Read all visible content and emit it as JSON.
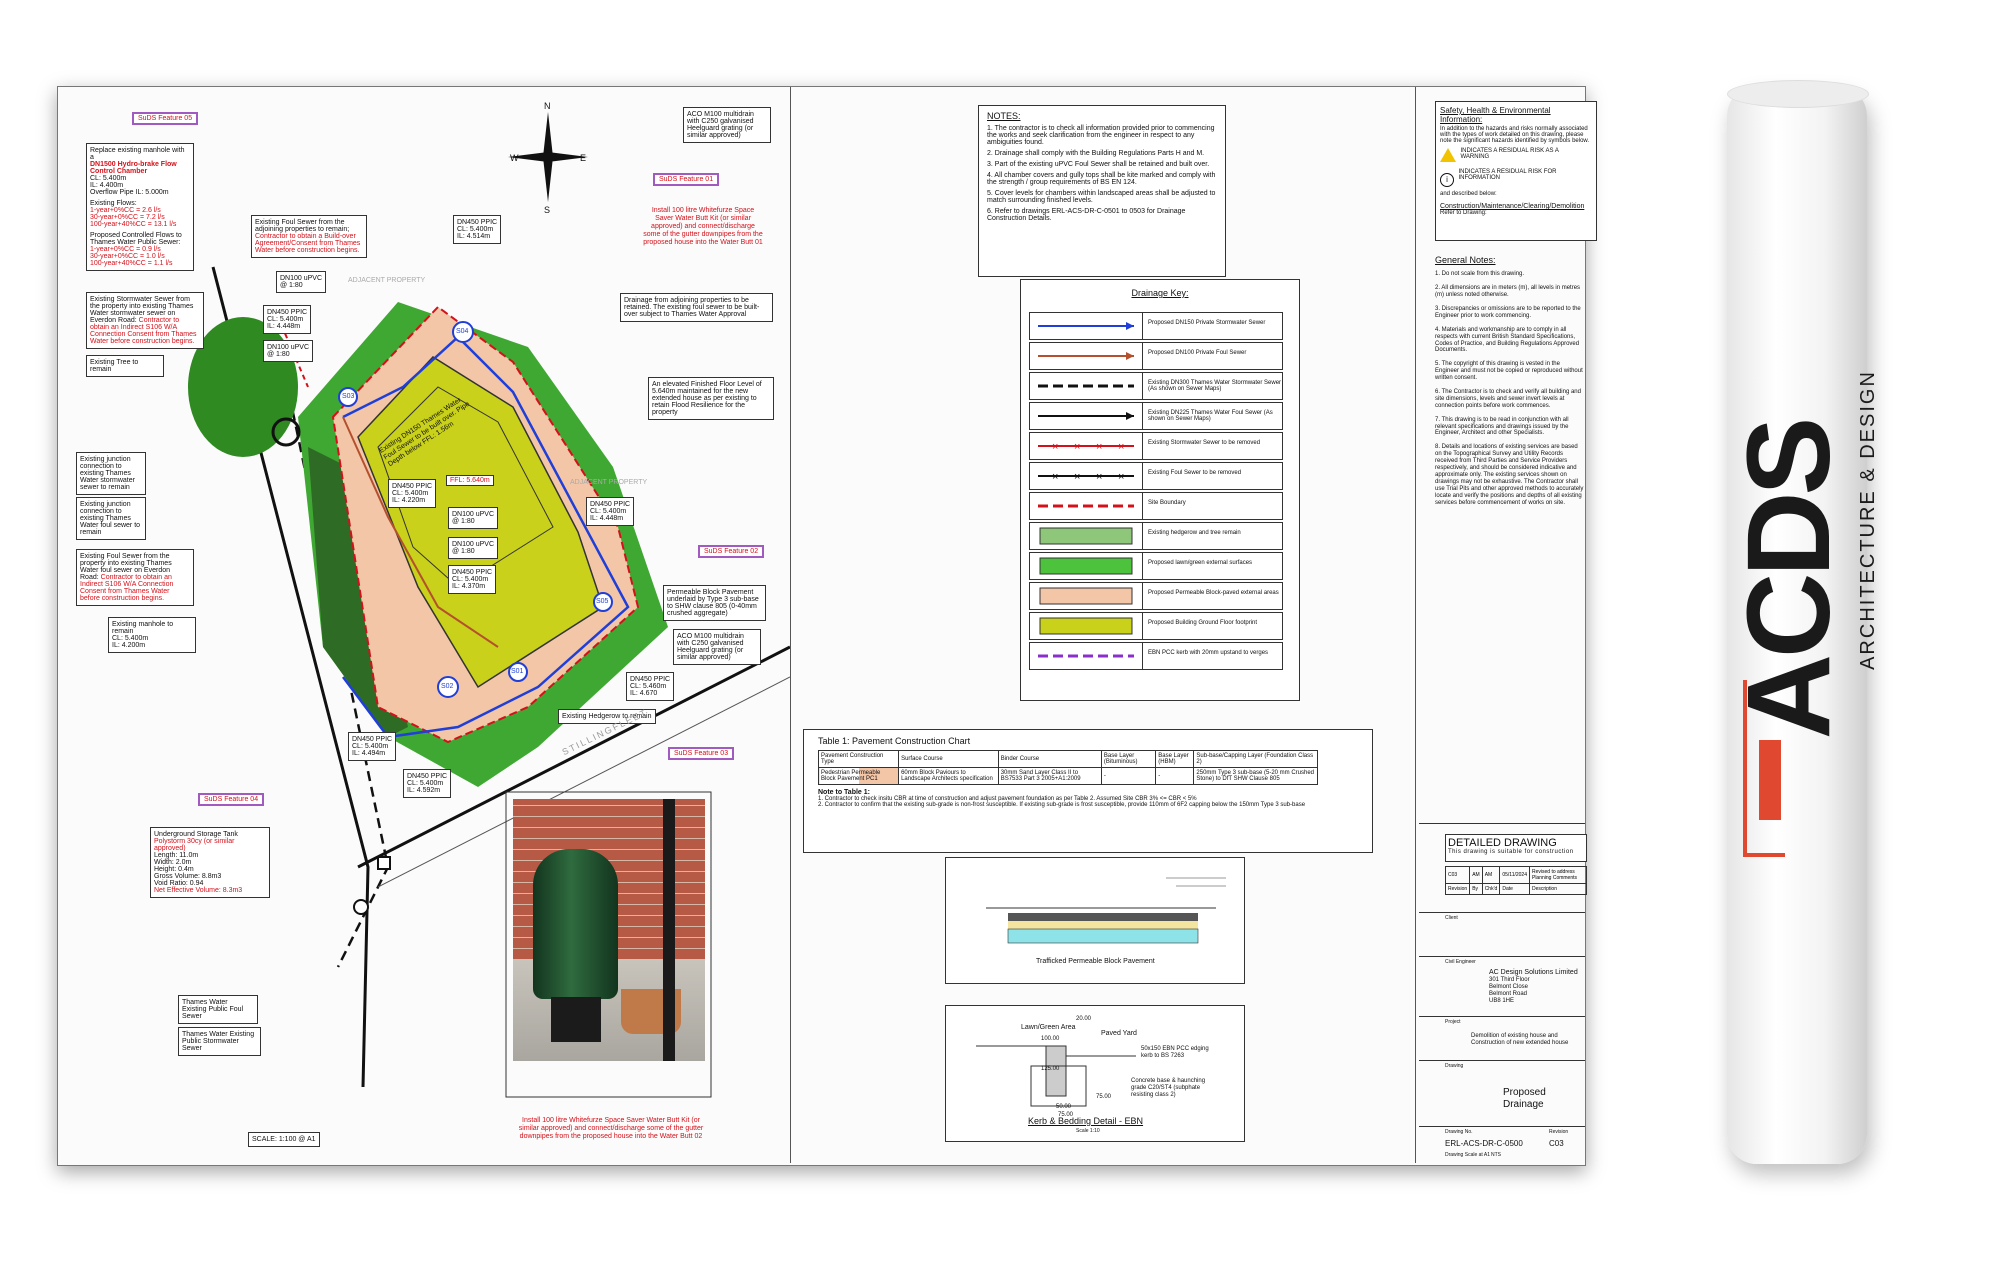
{
  "site_plan": {
    "suds_tags": [
      "SuDS Feature 05",
      "SuDS Feature 01",
      "SuDS Feature 02",
      "SuDS Feature 03",
      "SuDS Feature 04"
    ],
    "north": {
      "n": "N",
      "s": "S",
      "e": "E",
      "w": "W"
    },
    "manhole_callout": {
      "title_a": "Replace existing manhole with a",
      "title_b": "DN1500 Hydro-brake Flow Control Chamber",
      "lines": [
        "CL: 5.400m",
        "IL: 4.400m",
        "Overflow Pipe IL: 5.000m"
      ],
      "flows_title": "Existing Flows:",
      "flows": [
        "1-year+0%CC = 2.6 l/s",
        "30-year+0%CC = 7.2 l/s",
        "100-year+40%CC = 13.1 l/s"
      ],
      "proposed_title": "Proposed Controlled Flows to Thames Water Public Sewer:",
      "proposed": [
        "1-year+0%CC = 0.9 l/s",
        "30-year+0%CC = 1.0 l/s",
        "100-year+40%CC = 1.1 l/s"
      ]
    },
    "notes_left": [
      "Existing Stormwater Sewer from the property into existing Thames Water stormwater sewer on Everdon Road:",
      "Existing Tree to remain",
      "Existing junction connection to existing Thames Water stormwater sewer to remain",
      "Existing junction connection to existing Thames Water foul sewer to remain",
      "Existing Foul Sewer from the property into existing Thames Water foul sewer on Everdon Road:",
      "Existing manhole to remain"
    ],
    "notes_red_left": [
      "Contractor to obtain an Indirect S106 W/A Connection Consent from Thames Water before construction begins.",
      "Contractor to obtain an Indirect S106 W/A Connection Consent from Thames Water before construction begins."
    ],
    "manhole_left": [
      "CL: 5.400m",
      "IL: 4.200m"
    ],
    "foul_sewer_note": "Existing Foul Sewer from the adjoining properties to remain;",
    "foul_sewer_red": "Contractor to obtain a Build-over Agreement/Consent from Thames Water before construction begins.",
    "pipe_labels": [
      {
        "t": "DN100 uPVC",
        "v": "@ 1:80"
      },
      {
        "t": "DN450 PPIC",
        "v": "CL: 5.400m",
        "w": "IL: 4.448m"
      },
      {
        "t": "DN100 uPVC",
        "v": "@ 1:80"
      },
      {
        "t": "DN450 PPIC",
        "v": "CL: 5.400m",
        "w": "IL: 4.514m"
      },
      {
        "t": "DN450 PPIC",
        "v": "CL: 5.400m",
        "w": "IL: 4.220m"
      },
      {
        "t": "DN100 uPVC",
        "v": "@ 1:80"
      },
      {
        "t": "DN100 uPVC",
        "v": "@ 1:80"
      },
      {
        "t": "DN450 PPIC",
        "v": "CL: 5.400m",
        "w": "IL: 4.370m"
      },
      {
        "t": "DN450 PPIC",
        "v": "CL: 5.400m",
        "w": "IL: 4.448m"
      },
      {
        "t": "DN450 PPIC",
        "v": "CL: 5.400m",
        "w": "IL: 4.494m"
      },
      {
        "t": "DN450 PPIC",
        "v": "CL: 5.400m",
        "w": "IL: 4.592m"
      },
      {
        "t": "DN450 PPIC",
        "v": "CL: 5.460m",
        "w": "IL: 4.670"
      }
    ],
    "ffl": "FFL: 5.640m",
    "house_label": "Existing DN150 Thames Water Foul Sewer to be built over. Pipe Depth below FFL: 1.56m",
    "aco_top": "ACO M100 multidrain with C250 galvanised Heelguard grating (or similar approved)",
    "butt_top_red": "Install 100 litre Whitefurze Space Saver Water Butt Kit (or similar approved) and connect/discharge some of the gutter downpipes from the proposed house into the Water Butt 01",
    "drainage_adjoining": "Drainage from adjoining properties to be retained. The existing foul sewer to be built-over subject to Thames Water Approval",
    "floor_level": "An elevated Finished Floor Level of 5.640m maintained for the new extended house as per existing to retain Flood Resilience for the property",
    "permeable": "Permeable Block Pavement underlaid by Type 3 sub-base to SHW clause 805 (0-40mm crushed aggregate)",
    "aco_mid": "ACO M100 multidrain with C250 galvanised Heelguard grating (or similar approved)",
    "hedgerow": "Existing Hedgerow to remain",
    "storage_title": "Underground Storage Tank",
    "storage_red": "Polystorm 30cy (or similar approved)",
    "storage": [
      "Length: 11.0m",
      "Width: 2.0m",
      "Height: 0.4m",
      "Gross Volume: 8.8m3",
      "Void Ratio: 0.94"
    ],
    "storage_net": "Net Effective Volume: 8.3m3",
    "tw_foul": "Thames Water Existing Public Foul Sewer",
    "tw_storm": "Thames Water Existing Public Stormwater Sewer",
    "butt_photo_red": "Install 100 litre Whitefurze Space Saver Water Butt Kit (or similar approved) and connect/discharge some of the gutter downpipes from the proposed house into the Water Butt 02",
    "scale": "SCALE: 1:100 @ A1",
    "road": "STILLINGFLEET",
    "adjacent1": "ADJACENT PROPERTY",
    "adjacent2": "ADJACENT PROPERTY",
    "manholes": [
      "S04",
      "S03",
      "S05",
      "S02",
      "S01"
    ]
  },
  "notes": {
    "title": "NOTES:",
    "items": [
      "1. The contractor is to check all information provided prior to commencing the works and seek clarification from the engineer in respect to any ambiguities found.",
      "2. Drainage shall comply with the Building Regulations Parts H and M.",
      "3. Part of the existing uPVC Foul Sewer shall be retained and built over.",
      "4. All chamber covers and gully tops shall be kite marked and comply with the strength / group requirements of BS EN 124.",
      "5. Cover levels for chambers within landscaped areas shall be adjusted to match surrounding finished levels.",
      "6. Refer to drawings ERL-ACS-DR-C-0501 to 0503 for Drainage Construction Details."
    ]
  },
  "drainage_key": {
    "title": "Drainage Key:",
    "items": [
      {
        "label": "Proposed DN150 Private Stormwater Sewer",
        "kind": "line",
        "color": "#1f3fd8"
      },
      {
        "label": "Proposed DN100 Private Foul Sewer",
        "kind": "line",
        "color": "#b5502e"
      },
      {
        "label": "Existing DN300 Thames Water Stormwater Sewer (As shown on Sewer Maps)",
        "kind": "dash",
        "color": "#111111"
      },
      {
        "label": "Existing DN225 Thames Water Foul Sewer (As shown on Sewer Maps)",
        "kind": "line",
        "color": "#111111"
      },
      {
        "label": "Existing Stormwater Sewer to be removed",
        "kind": "cross",
        "color": "#d4111a"
      },
      {
        "label": "Existing Foul Sewer to be removed",
        "kind": "cross",
        "color": "#111111"
      },
      {
        "label": "Site Boundary",
        "kind": "dash",
        "color": "#d4111a"
      },
      {
        "label": "Existing hedgerow and tree remain",
        "kind": "fill",
        "color": "#8fc77a"
      },
      {
        "label": "Proposed lawn/green external surfaces",
        "kind": "fill",
        "color": "#4dc23d"
      },
      {
        "label": "Proposed Permeable Block-paved external areas",
        "kind": "fill",
        "color": "#f3c6a7"
      },
      {
        "label": "Proposed Building Ground Floor footprint",
        "kind": "fill",
        "color": "#c9d11a"
      },
      {
        "label": "EBN PCC kerb with 20mm upstand to verges",
        "kind": "dash",
        "color": "#8a2fc9"
      }
    ]
  },
  "pavement": {
    "title": "Table 1: Pavement Construction Chart",
    "headers": [
      "Pavement Construction Type",
      "Surface Course",
      "Binder Course",
      "Base Layer (Bituminous)",
      "Base Layer (HBM)",
      "Sub-base/Capping Layer (Foundation Class 2)"
    ],
    "row": [
      "Pedestrian Permeable Block Pavement PC1",
      "60mm Block Paviours to Landscape Architects specification",
      "30mm Sand Layer Class II to BS7533 Part 3 2005+A1:2009",
      "-",
      "-",
      "250mm Type 3 sub-base (5-20 mm Crushed Stone) to DfT SHW Clause 805"
    ],
    "note_title": "Note to Table 1:",
    "notes": [
      "1. Contractor to check insitu CBR at time of construction and adjust pavement foundation as per Table 2. Assumed Site CBR 3% <= CBR < 5%",
      "2. Contractor to confirm that the existing sub-grade is non-frost susceptible. If existing sub-grade is frost susceptible, provide 110mm of 6F2 capping below the 150mm Type 3 sub-base"
    ]
  },
  "details": {
    "permeable_title": "Trafficked Permeable Block Pavement",
    "kerb_title": "Kerb & Bedding Detail - EBN",
    "kerb_scale": "Scale 1:10",
    "kerb_labels": [
      "Lawn/Green Area",
      "Paved Yard",
      "50x150 EBN PCC edging kerb to BS 7263",
      "Concrete base & haunching grade C20/ST4 (subphate resisting class 2)"
    ],
    "dims": [
      "20.00",
      "100.00",
      "125.00",
      "75.00",
      "50.00",
      "75.00"
    ]
  },
  "general": {
    "she_title": "Safety, Health & Environmental Information:",
    "she_text": "In addition to the hazards and risks normally associated with the types of work detailed on this drawing, please note the significant hazards identified by symbols below.",
    "warn": "INDICATES A RESIDUAL RISK AS A WARNING",
    "info": "INDICATES A RESIDUAL RISK FOR INFORMATION",
    "described": "and described below:",
    "cmcd": "Construction/Maintenance/Clearing/Demolition",
    "refer": "Refer to Drawing:",
    "title": "General Notes:",
    "items": [
      "1. Do not scale from this drawing.",
      "2. All dimensions are in meters (m), all levels in metres (m) unless noted otherwise.",
      "3. Discrepancies or omissions are to be reported to the Engineer prior to work commencing.",
      "4. Materials and workmanship are to comply in all respects with current British Standard Specifications, Codes of Practice, and Building Regulations Approved Documents.",
      "5. The copyright of this drawing is vested in the Engineer and must not be copied or reproduced without written consent.",
      "6. The Contractor is to check and verify all building and site dimensions, levels and sewer invert levels at connection points before work commences.",
      "7. This drawing is to be read in conjunction with all relevant specifications and drawings issued by the Engineer, Architect and other Specialists.",
      "8. Details and locations of existing services are based on the Topographical Survey and Utility Records received from Third Parties and Service Providers respectively, and should be considered indicative and approximate only. The existing services shown on drawings may not be exhaustive. The Contractor shall use Trial Pits and other approved methods to accurately locate and verify the positions and depths of all existing services before commencement of works on site."
    ]
  },
  "title_block": {
    "status": "DETAILED DRAWING",
    "status_sub": "This drawing is suitable for construction",
    "rev_row": [
      "C03",
      "AM",
      "AM",
      "05/11/2024",
      "Revised to address Planning Comments"
    ],
    "rev_head": [
      "Revision",
      "By",
      "Chk'd",
      "Date",
      "Description"
    ],
    "client_label": "Client",
    "engineer_label": "Civil Engineer",
    "engineer": [
      "AC Design Solutions Limited",
      "301 Third Floor",
      "Belmont Close",
      "Belmont Road",
      "UB8 1HE"
    ],
    "project_label": "Project",
    "project": "Demolition of existing house and Construction of new extended house",
    "drawing_label": "Drawing",
    "drawing": "Proposed Drainage",
    "drawing_no_label": "Drawing No.",
    "drawing_no": "ERL-ACS-DR-C-0500",
    "revision_label": "Revision",
    "revision": "C03",
    "scale_label": "Drawing Scale at A1",
    "scale": "NTS"
  },
  "brand": {
    "logo": "ACDS",
    "tagline": "ARCHITECTURE & DESIGN",
    "accent": "#e0492f"
  }
}
